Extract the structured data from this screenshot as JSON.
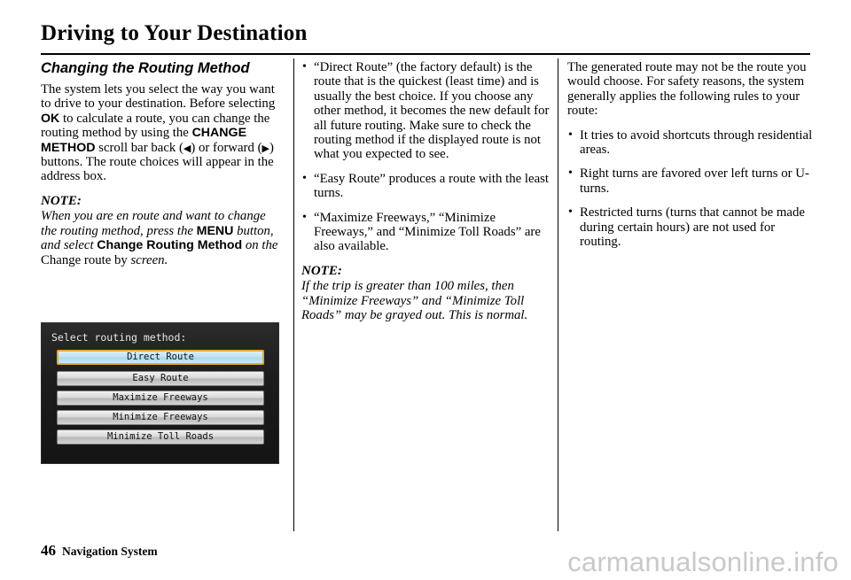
{
  "document": {
    "title": "Driving to Your Destination",
    "footer": {
      "page_number": "46",
      "section": "Navigation System",
      "watermark": "carmanualsonline.info"
    }
  },
  "column1": {
    "heading": "Changing the Routing Method",
    "paragraph_part1": "The system lets you select the way you want to drive to your destination. Before selecting ",
    "ok_label": "OK",
    "paragraph_part2": " to calculate a route, you can change the routing method by using the ",
    "change_method_label": "CHANGE METHOD",
    "paragraph_part3": " scroll bar back (",
    "back_arrow": "◀",
    "paragraph_part4": ") or forward (",
    "forward_arrow": "▶",
    "paragraph_part5": ") buttons. The route choices will appear in the address box.",
    "note_label": "NOTE:",
    "note_part1": "When you are en route and want to change the routing method, press the ",
    "menu_label": "MENU",
    "note_part2": " button, and select ",
    "change_routing_method_label": "Change Routing Method",
    "note_part3": " on the ",
    "change_route_label": "Change route by",
    "note_part4": " screen."
  },
  "nav_screen": {
    "title": "Select routing method:",
    "options": [
      {
        "label": "Direct Route",
        "selected": true
      },
      {
        "label": "Easy Route",
        "selected": false
      },
      {
        "label": "Maximize Freeways",
        "selected": false
      },
      {
        "label": "Minimize Freeways",
        "selected": false
      },
      {
        "label": "Minimize Toll Roads",
        "selected": false
      }
    ],
    "selection_border_color": "#e2a93a",
    "selection_fill_color": "#bfe4f4"
  },
  "column2": {
    "bullets": [
      "“Direct Route” (the factory default) is the route that is the quickest (least time) and is usually the best choice. If you choose any other method, it becomes the new default for all future routing. Make sure to check the routing method if the displayed route is not what you expected to see.",
      "“Easy Route” produces a route with the least turns.",
      "“Maximize Freeways,” “Minimize Freeways,” and “Minimize Toll Roads” are also available."
    ],
    "note_label": "NOTE:",
    "note_body": "If the trip is greater than 100 miles, then “Minimize Freeways” and “Minimize Toll Roads” may be grayed out. This is normal."
  },
  "column3": {
    "intro": "The generated route may not be the route you would choose. For safety reasons, the system generally applies the following rules to your route:",
    "bullets": [
      "It tries to avoid shortcuts through residential areas.",
      "Right turns are favored over left turns or U-turns.",
      "Restricted turns (turns that cannot be made during certain hours) are not used for routing."
    ]
  }
}
